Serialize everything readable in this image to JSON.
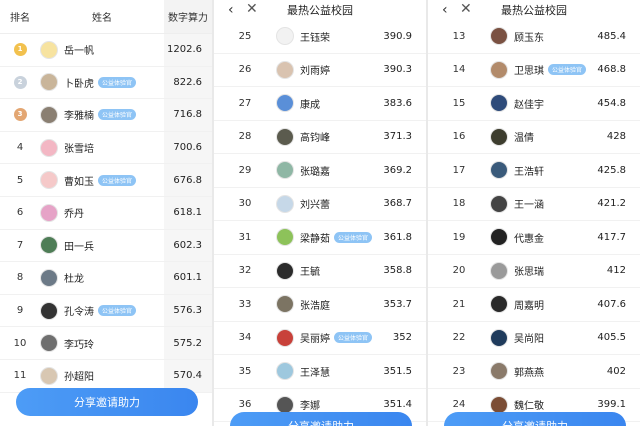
{
  "panel1": {
    "header": {
      "rank": "排名",
      "name": "姓名",
      "score": "数字算力"
    },
    "rows": [
      {
        "rank": "1",
        "medal": "gold",
        "name": "岳一帆",
        "badge": "",
        "score": "1202.6",
        "color": "#f7e3a0"
      },
      {
        "rank": "2",
        "medal": "silver",
        "name": "卜卧虎",
        "badge": "公益体验官",
        "score": "822.6",
        "color": "#c9b59a"
      },
      {
        "rank": "3",
        "medal": "bronze",
        "name": "李雅楠",
        "badge": "公益体验官",
        "score": "716.8",
        "color": "#8a7f72"
      },
      {
        "rank": "4",
        "medal": "",
        "name": "张雪培",
        "badge": "",
        "score": "700.6",
        "color": "#f3b7c4"
      },
      {
        "rank": "5",
        "medal": "",
        "name": "曹如玉",
        "badge": "公益体验官",
        "score": "676.8",
        "color": "#f5c9c9"
      },
      {
        "rank": "6",
        "medal": "",
        "name": "乔丹",
        "badge": "",
        "score": "618.1",
        "color": "#e6a3c7"
      },
      {
        "rank": "7",
        "medal": "",
        "name": "田一兵",
        "badge": "",
        "score": "602.3",
        "color": "#4e7d56"
      },
      {
        "rank": "8",
        "medal": "",
        "name": "杜龙",
        "badge": "",
        "score": "601.1",
        "color": "#6c7a87"
      },
      {
        "rank": "9",
        "medal": "",
        "name": "孔令涛",
        "badge": "公益体验官",
        "score": "576.3",
        "color": "#333333"
      },
      {
        "rank": "10",
        "medal": "",
        "name": "李巧玲",
        "badge": "",
        "score": "575.2",
        "color": "#6f6f6f"
      },
      {
        "rank": "11",
        "medal": "",
        "name": "孙超阳",
        "badge": "",
        "score": "570.4",
        "color": "#d8c7b2"
      }
    ],
    "share_label": "分享邀请助力"
  },
  "panel2": {
    "title": "最热公益校园",
    "rows": [
      {
        "rank": "25",
        "name": "王钰荣",
        "badge": "",
        "score": "390.9",
        "color": "#f2f2f2"
      },
      {
        "rank": "26",
        "name": "刘雨婷",
        "badge": "",
        "score": "390.3",
        "color": "#d9c3b0"
      },
      {
        "rank": "27",
        "name": "康成",
        "badge": "",
        "score": "383.6",
        "color": "#5a8fd8"
      },
      {
        "rank": "28",
        "name": "高钧峰",
        "badge": "",
        "score": "371.3",
        "color": "#5b5b4e"
      },
      {
        "rank": "29",
        "name": "张璐嘉",
        "badge": "",
        "score": "369.2",
        "color": "#8fb7a5"
      },
      {
        "rank": "30",
        "name": "刘兴蕾",
        "badge": "",
        "score": "368.7",
        "color": "#c6d8e8"
      },
      {
        "rank": "31",
        "name": "梁静茹",
        "badge": "公益体验官",
        "score": "361.8",
        "color": "#8dc25a"
      },
      {
        "rank": "32",
        "name": "王毓",
        "badge": "",
        "score": "358.8",
        "color": "#2b2b2b"
      },
      {
        "rank": "33",
        "name": "张浩庭",
        "badge": "",
        "score": "353.7",
        "color": "#7c7463"
      },
      {
        "rank": "34",
        "name": "吴丽婷",
        "badge": "公益体验官",
        "score": "352",
        "color": "#c8413a"
      },
      {
        "rank": "35",
        "name": "王泽慧",
        "badge": "",
        "score": "351.5",
        "color": "#9ec8de"
      },
      {
        "rank": "36",
        "name": "李娜",
        "badge": "",
        "score": "351.4",
        "color": "#555555"
      }
    ],
    "share_label": "分享邀请助力"
  },
  "panel3": {
    "title": "最热公益校园",
    "rows": [
      {
        "rank": "13",
        "name": "顾玉东",
        "badge": "",
        "score": "485.4",
        "color": "#7a5142"
      },
      {
        "rank": "14",
        "name": "卫思琪",
        "badge": "公益体验官",
        "score": "468.8",
        "color": "#b28b6b"
      },
      {
        "rank": "15",
        "name": "赵佳宇",
        "badge": "",
        "score": "454.8",
        "color": "#2e4b7a"
      },
      {
        "rank": "16",
        "name": "温倩",
        "badge": "",
        "score": "428",
        "color": "#3d3d2e"
      },
      {
        "rank": "17",
        "name": "王浩轩",
        "badge": "",
        "score": "425.8",
        "color": "#3a5a7a"
      },
      {
        "rank": "18",
        "name": "王一涵",
        "badge": "",
        "score": "421.2",
        "color": "#444444"
      },
      {
        "rank": "19",
        "name": "代惠金",
        "badge": "",
        "score": "417.7",
        "color": "#222222"
      },
      {
        "rank": "20",
        "name": "张思瑞",
        "badge": "",
        "score": "412",
        "color": "#9a9a9a"
      },
      {
        "rank": "21",
        "name": "周嘉明",
        "badge": "",
        "score": "407.6",
        "color": "#2a2a2a"
      },
      {
        "rank": "22",
        "name": "吴尚阳",
        "badge": "",
        "score": "405.5",
        "color": "#1f3b5c"
      },
      {
        "rank": "23",
        "name": "郭燕燕",
        "badge": "",
        "score": "402",
        "color": "#8a7a6a"
      },
      {
        "rank": "24",
        "name": "魏仁敬",
        "badge": "",
        "score": "399.1",
        "color": "#7b4d35"
      }
    ],
    "share_label": "分享邀请助力"
  },
  "colors": {
    "accent": "#4d9cf6",
    "badge": "#8ec4f5",
    "gold": "#f2c14e",
    "silver": "#c9d2dc",
    "bronze": "#e3a672"
  }
}
